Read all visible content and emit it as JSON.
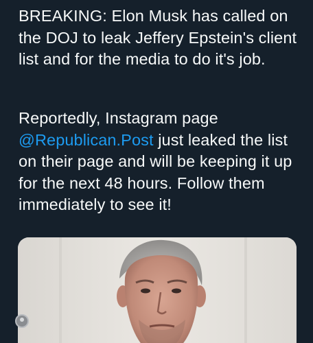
{
  "tweet": {
    "paragraph1": "BREAKING: Elon Musk has called on the DOJ to leak Jeffery Epstein's client list and for the media to do it's job.",
    "paragraph2_before": "Reportedly, Instagram page ",
    "mention": "@Republican.Post",
    "paragraph2_after": " just leaked the list on their page and will be keeping it up for the next 48 hours. Follow them immediately to see it!"
  },
  "media": {
    "description_icon": "photo"
  },
  "colors": {
    "background": "#15202b",
    "text": "#f7f9f9",
    "link": "#1d9bf0"
  }
}
